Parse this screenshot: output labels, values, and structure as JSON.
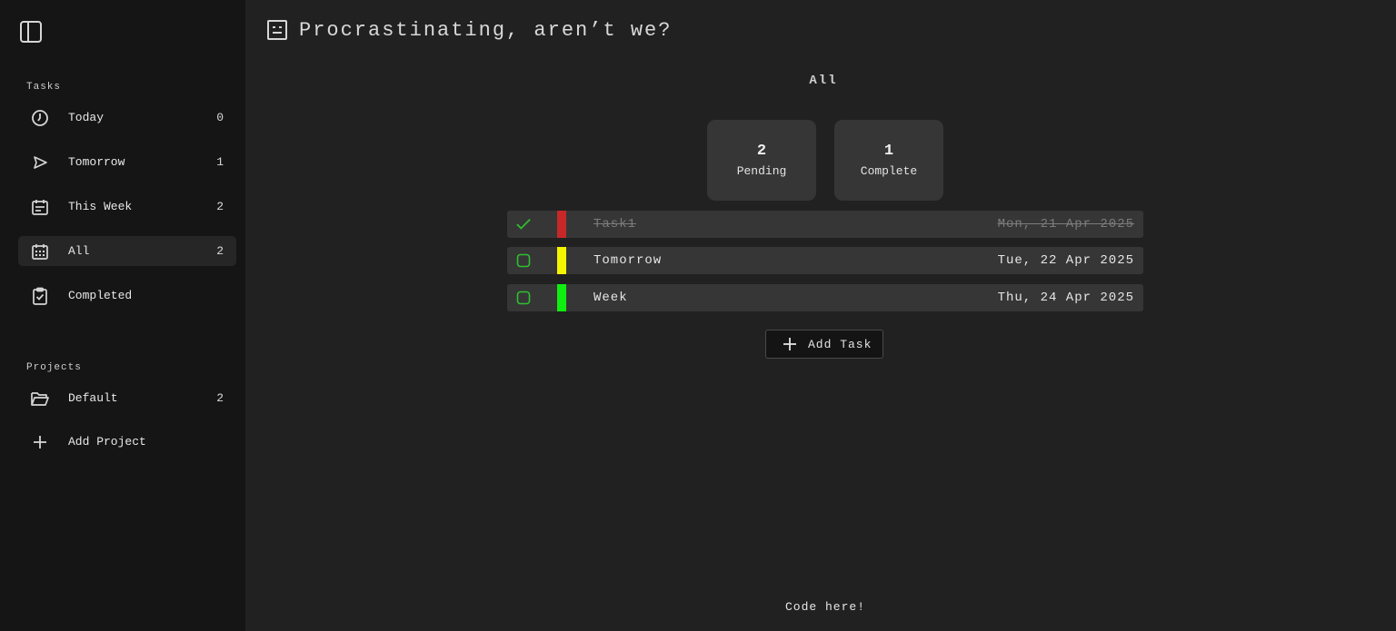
{
  "header": {
    "title": "Procrastinating, aren’t we?",
    "title_icon": "emoticon-face-icon"
  },
  "sidebar": {
    "toggle_icon": "sidebar-panel-icon",
    "tasks_section_label": "Tasks",
    "task_items": [
      {
        "label": "Today",
        "count": "0",
        "icon": "clock-icon"
      },
      {
        "label": "Tomorrow",
        "count": "1",
        "icon": "send-arrow-icon"
      },
      {
        "label": "This Week",
        "count": "2",
        "icon": "calendar-week-icon"
      },
      {
        "label": "All",
        "count": "2",
        "icon": "calendar-grid-icon",
        "active": true
      },
      {
        "label": "Completed",
        "count": "",
        "icon": "clipboard-check-icon"
      }
    ],
    "projects_section_label": "Projects",
    "project_items": [
      {
        "label": "Default",
        "count": "2",
        "icon": "folder-open-icon"
      }
    ],
    "add_project_label": "Add Project"
  },
  "main": {
    "view_title": "All",
    "stats": [
      {
        "number": "2",
        "label": "Pending"
      },
      {
        "number": "1",
        "label": "Complete"
      }
    ],
    "tasks": [
      {
        "name": "Task1",
        "date": "Mon, 21 Apr 2025",
        "done": true,
        "priority_color": "#c62828"
      },
      {
        "name": "Tomorrow",
        "date": "Tue, 22 Apr 2025",
        "done": false,
        "priority_color": "#f5f500"
      },
      {
        "name": "Week",
        "date": "Thu, 24 Apr 2025",
        "done": false,
        "priority_color": "#10ee10"
      }
    ],
    "add_task_label": "Add Task",
    "footer_link": "Code here!"
  },
  "colors": {
    "checkbox_green": "#2fbf2f",
    "sidebar_bg": "#151515",
    "main_bg": "#212121",
    "card_bg": "#363636"
  }
}
